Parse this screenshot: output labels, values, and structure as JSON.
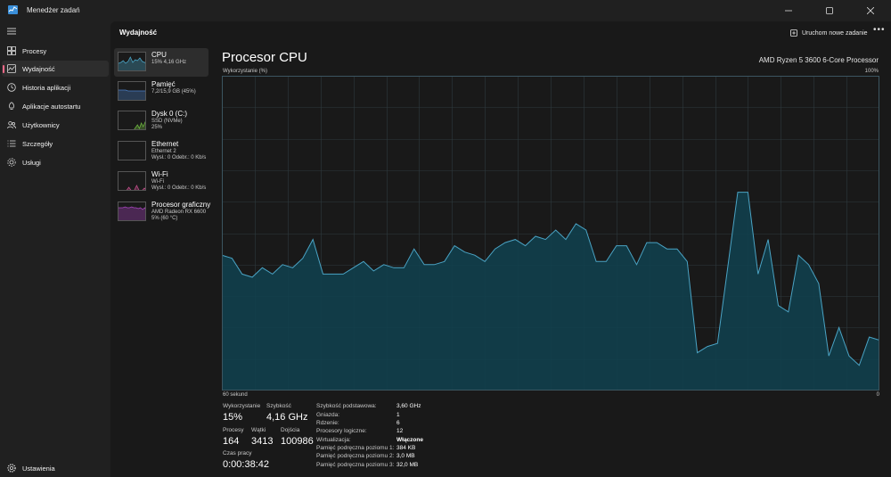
{
  "window": {
    "title": "Menedżer zadań"
  },
  "sidebar": {
    "items": [
      {
        "label": "Procesy",
        "icon": "grid-icon",
        "active": false
      },
      {
        "label": "Wydajność",
        "icon": "performance-icon",
        "active": true
      },
      {
        "label": "Historia aplikacji",
        "icon": "history-icon",
        "active": false
      },
      {
        "label": "Aplikacje autostartu",
        "icon": "startup-icon",
        "active": false
      },
      {
        "label": "Użytkownicy",
        "icon": "users-icon",
        "active": false
      },
      {
        "label": "Szczegóły",
        "icon": "details-icon",
        "active": false
      },
      {
        "label": "Usługi",
        "icon": "services-icon",
        "active": false
      }
    ],
    "settings_label": "Ustawienia"
  },
  "header": {
    "section_title": "Wydajność",
    "run_task_label": "Uruchom nowe zadanie"
  },
  "devices": [
    {
      "name": "CPU",
      "line1": "15% 4,16 GHz",
      "line2": "",
      "color": "#4aa3c4",
      "active": true
    },
    {
      "name": "Pamięć",
      "line1": "7,2/15,9 GB (45%)",
      "line2": "",
      "color": "#4a7ec4",
      "active": false
    },
    {
      "name": "Dysk 0 (C:)",
      "line1": "SSD (NVMe)",
      "line2": "25%",
      "color": "#6cb33f",
      "active": false
    },
    {
      "name": "Ethernet",
      "line1": "Ethernet 2",
      "line2": "Wysł.: 0 Odebr.: 0 Kb/s",
      "color": "#c7a14a",
      "active": false
    },
    {
      "name": "Wi-Fi",
      "line1": "Wi-Fi",
      "line2": "Wysł.: 0 Odebr.: 0 Kb/s",
      "color": "#c24d8a",
      "active": false
    },
    {
      "name": "Procesor graficzny",
      "line1": "AMD Radeon RX 6600",
      "line2": "5% (60 °C)",
      "color": "#a946c0",
      "active": false
    }
  ],
  "cpu": {
    "title": "Procesor CPU",
    "processor_name": "AMD Ryzen 5 3600 6-Core Processor",
    "utilization_label": "Wykorzystanie (%)",
    "max_label": "100%",
    "time_label": "60 sekund",
    "min_label": "0",
    "stats": {
      "utilization_label": "Wykorzystanie",
      "utilization_value": "15%",
      "speed_label": "Szybkość",
      "speed_value": "4,16 GHz",
      "processes_label": "Procesy",
      "processes_value": "164",
      "threads_label": "Wątki",
      "threads_value": "3413",
      "handles_label": "Dojścia",
      "handles_value": "100986",
      "uptime_label": "Czas pracy",
      "uptime_value": "0:00:38:42"
    },
    "details": [
      {
        "key": "Szybkość podstawowa:",
        "value": "3,60 GHz"
      },
      {
        "key": "Gniazda:",
        "value": "1"
      },
      {
        "key": "Rdzenie:",
        "value": "6"
      },
      {
        "key": "Procesory logiczne:",
        "value": "12"
      },
      {
        "key": "Wirtualizacja:",
        "value": "Włączone"
      },
      {
        "key": "Pamięć podręczna poziomu 1:",
        "value": "384 KB"
      },
      {
        "key": "Pamięć podręczna poziomu 2:",
        "value": "3,0 MB"
      },
      {
        "key": "Pamięć podręczna poziomu 3:",
        "value": "32,0 MB"
      }
    ]
  },
  "chart_data": {
    "type": "area",
    "xlim": [
      60,
      0
    ],
    "ylim": [
      0,
      100
    ],
    "grid": true,
    "color": "#4aa3c4",
    "x": [
      60,
      59,
      58,
      57,
      56,
      55,
      54,
      53,
      52,
      51,
      50,
      49,
      48,
      47,
      46,
      45,
      44,
      43,
      42,
      41,
      40,
      39,
      38,
      37,
      36,
      35,
      34,
      33,
      32,
      31,
      30,
      29,
      28,
      27,
      26,
      25,
      24,
      23,
      22,
      21,
      20,
      19,
      18,
      17,
      16,
      15,
      14,
      13,
      12,
      11,
      10,
      9,
      8,
      7,
      6,
      5,
      4,
      3,
      2,
      1,
      0
    ],
    "values": [
      43,
      42,
      37,
      36,
      39,
      37,
      40,
      39,
      42,
      48,
      37,
      37,
      37,
      39,
      41,
      38,
      40,
      39,
      39,
      45,
      40,
      40,
      41,
      46,
      44,
      43,
      41,
      45,
      47,
      48,
      46,
      49,
      48,
      51,
      48,
      53,
      51,
      41,
      41,
      46,
      46,
      40,
      47,
      47,
      45,
      45,
      41,
      12,
      14,
      15,
      39,
      63,
      63,
      37,
      48,
      27,
      25,
      43,
      40,
      34,
      11,
      20,
      11,
      8,
      17,
      16
    ]
  }
}
